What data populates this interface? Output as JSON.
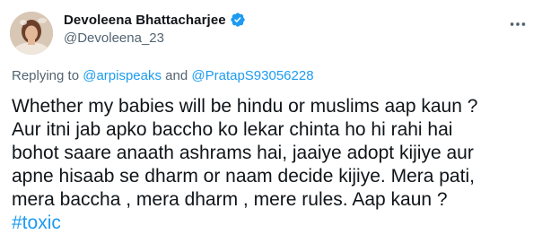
{
  "author": {
    "display_name": "Devoleena Bhattacharjee",
    "handle": "@Devoleena_23",
    "verified": true
  },
  "reply": {
    "prefix": "Replying to ",
    "mention_1": "@arpispeaks",
    "conjunction": " and ",
    "mention_2": "@PratapS93056228"
  },
  "tweet": {
    "text": "Whether my babies will be hindu or muslims aap kaun ?\nAur itni jab apko baccho ko lekar chinta ho hi rahi hai\nbohot saare anaath ashrams hai, jaaiye adopt kijiye aur\napne hisaab se dharm or naam decide kijiye. Mera pati,\nmera baccha , mera dharm , mere rules. Aap kaun ?",
    "hashtag": "#toxic"
  },
  "icons": {
    "verified": "verified-badge-icon",
    "more": "more-options-icon"
  },
  "colors": {
    "accent": "#1d9bf0",
    "text": "#0f1419",
    "secondary": "#536471"
  }
}
